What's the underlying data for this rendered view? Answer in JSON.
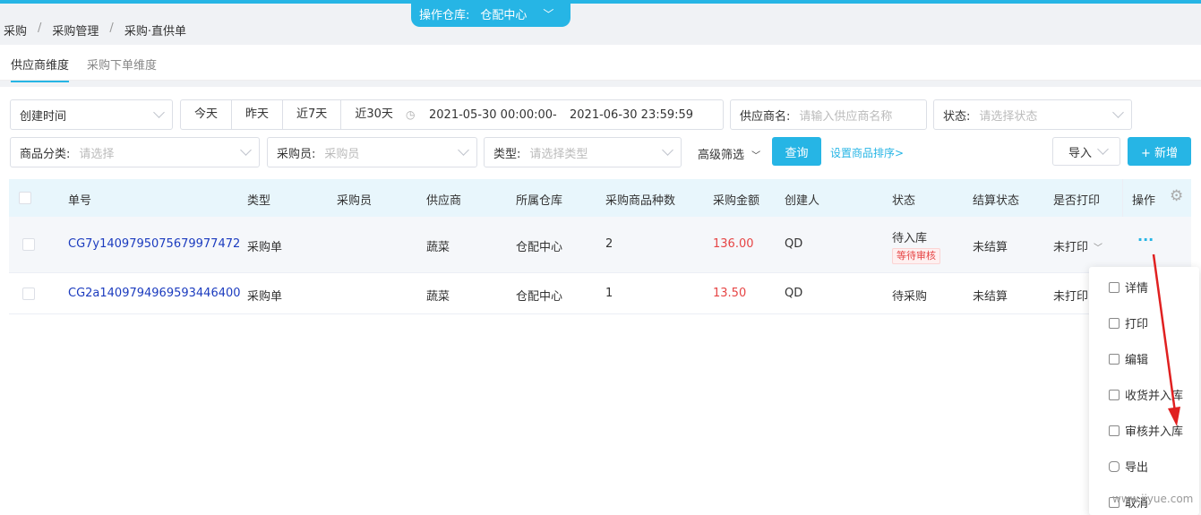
{
  "warehouse": {
    "label": "操作仓库:",
    "value": "仓配中心"
  },
  "breadcrumb": [
    "采购",
    "采购管理",
    "采购·直供单"
  ],
  "tabs": [
    "供应商维度",
    "采购下单维度"
  ],
  "filters": {
    "time_select": "创建时间",
    "quick_ranges": [
      "今天",
      "昨天",
      "近7天",
      "近30天"
    ],
    "date_start": "2021-05-30 00:00:00",
    "date_sep": "-",
    "date_end": "2021-06-30 23:59:59",
    "supplier_label": "供应商名:",
    "supplier_placeholder": "请输入供应商名称",
    "status_label": "状态:",
    "status_placeholder": "请选择状态",
    "category_label": "商品分类:",
    "category_placeholder": "请选择",
    "buyer_label": "采购员:",
    "buyer_placeholder": "采购员",
    "type_label": "类型:",
    "type_placeholder": "请选择类型",
    "advanced": "高级筛选",
    "query": "查询",
    "sort_link": "设置商品排序>",
    "import": "导入",
    "add": "+ 新增"
  },
  "table": {
    "headers": [
      "单号",
      "类型",
      "采购员",
      "供应商",
      "所属仓库",
      "采购商品种数",
      "采购金额",
      "创建人",
      "状态",
      "结算状态",
      "是否打印",
      "操作"
    ],
    "rows": [
      {
        "no": "CG7y1409795075679977472",
        "type": "采购单",
        "buyer": "",
        "supplier": "蔬菜",
        "warehouse": "仓配中心",
        "kinds": "2",
        "amount": "136.00",
        "creator": "QD",
        "status": "待入库",
        "badge": "等待审核",
        "settle": "未结算",
        "print": "未打印"
      },
      {
        "no": "CG2a1409794969593446400",
        "type": "采购单",
        "buyer": "",
        "supplier": "蔬菜",
        "warehouse": "仓配中心",
        "kinds": "1",
        "amount": "13.50",
        "creator": "QD",
        "status": "待采购",
        "badge": "",
        "settle": "未结算",
        "print": "未打印"
      }
    ]
  },
  "menu": [
    "详情",
    "打印",
    "编辑",
    "收货并入库",
    "审核并入库",
    "导出",
    "取消"
  ],
  "watermark": "www.jiyue.com",
  "colors": {
    "accent": "#26b5e5",
    "amount": "#e64545",
    "link": "#1c3cbf"
  }
}
